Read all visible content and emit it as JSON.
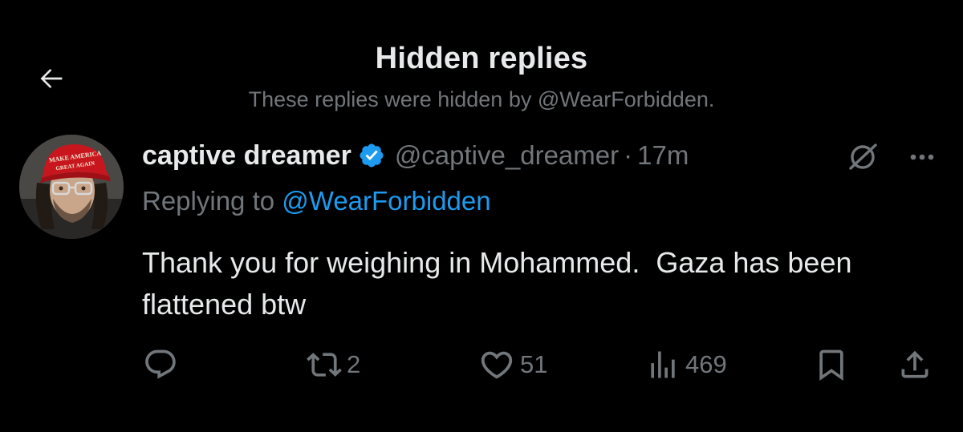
{
  "header": {
    "title": "Hidden replies",
    "subtitle": "These replies were hidden by @WearForbidden."
  },
  "tweet": {
    "display_name": "captive dreamer",
    "handle": "@captive_dreamer",
    "separator": "·",
    "timestamp": "17m",
    "replying_prefix": "Replying to ",
    "replying_to": "@WearForbidden",
    "text": "Thank you for weighing in Mohammed.  Gaza has been flattened btw",
    "avatar_hat_text": "MAKE AMERICA GREAT AGAIN",
    "counts": {
      "replies": "",
      "retweets": "2",
      "likes": "51",
      "views": "469"
    }
  },
  "icons": {
    "back": "arrow-left-icon",
    "verified": "verified-badge-icon",
    "hidden": "hidden-reply-icon",
    "more": "more-horizontal-icon",
    "reply": "reply-bubble-icon",
    "retweet": "retweet-icon",
    "like": "heart-icon",
    "views": "views-bar-chart-icon",
    "bookmark": "bookmark-icon",
    "share": "share-icon"
  },
  "colors": {
    "background": "#000000",
    "text_primary": "#e7e9ea",
    "text_secondary": "#71767b",
    "accent": "#1d9bf0"
  }
}
